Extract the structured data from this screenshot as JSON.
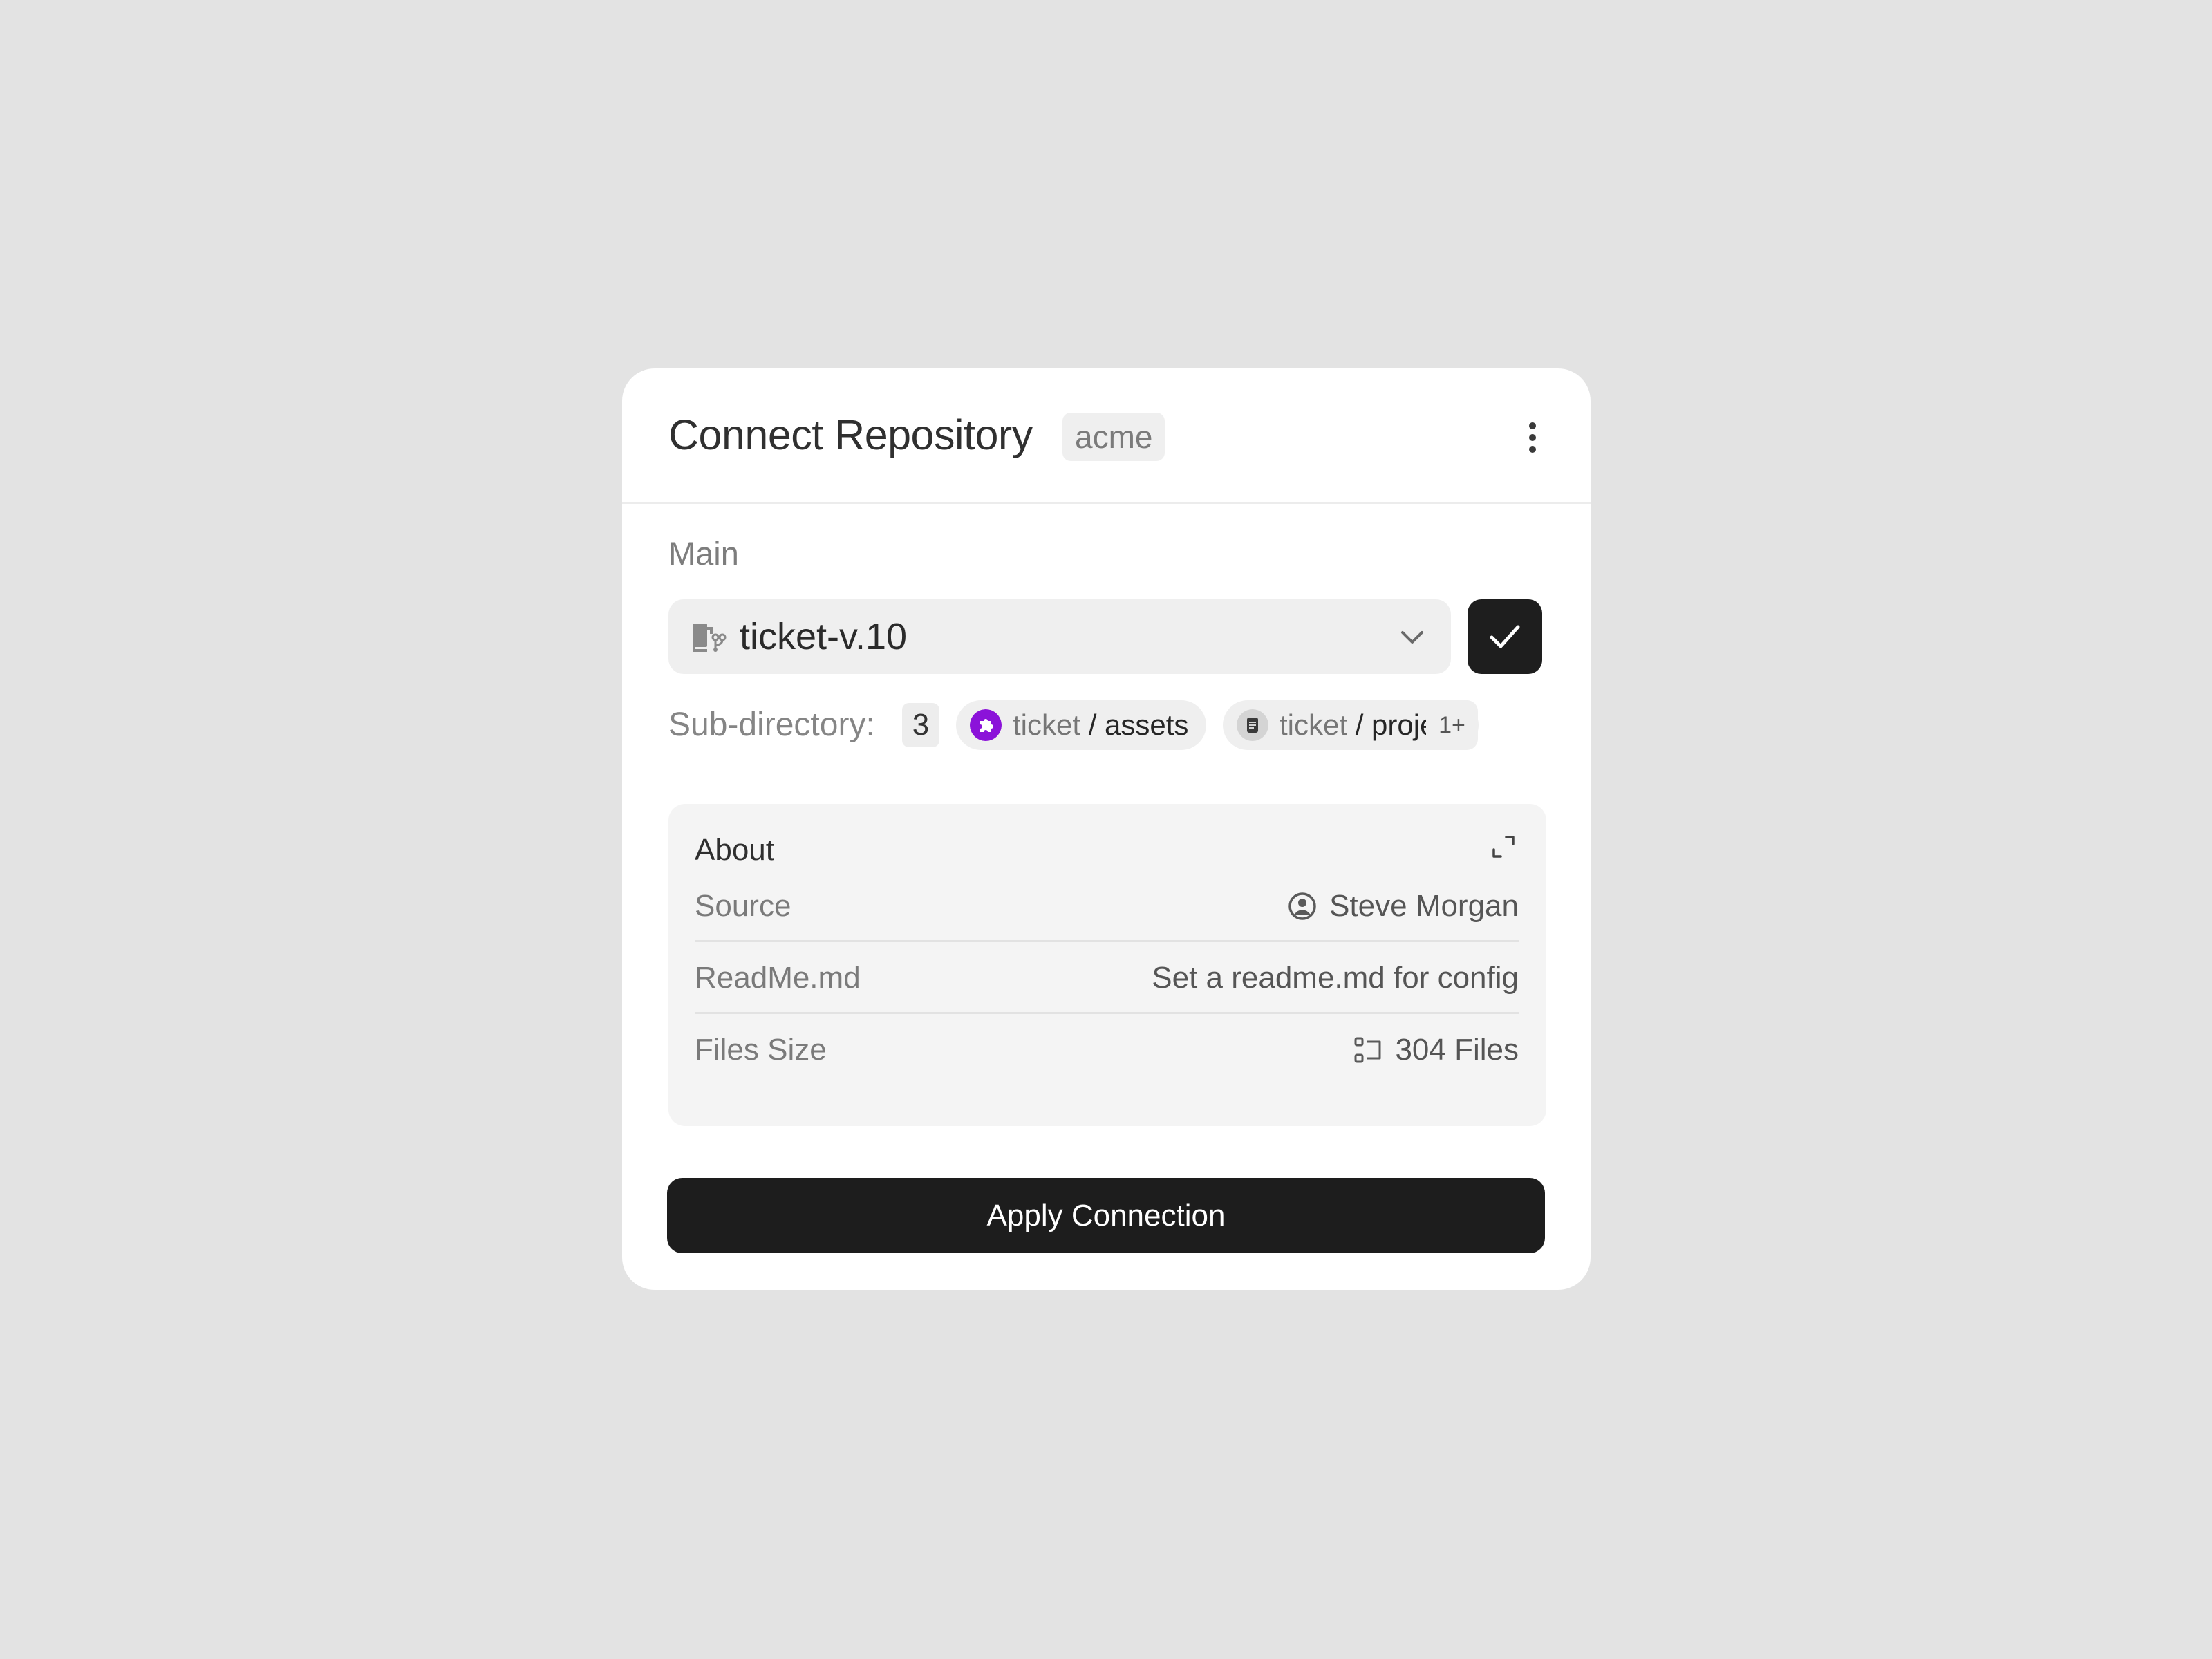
{
  "header": {
    "title": "Connect Repository",
    "org_badge": "acme",
    "more_icon": "more-vertical-icon"
  },
  "branch": {
    "section_label": "Main",
    "selected": "ticket-v.10",
    "icon": "folder-branch-icon",
    "dropdown_icon": "chevron-down-icon",
    "confirm_icon": "check-icon"
  },
  "subdirectory": {
    "label": "Sub-directory:",
    "count": "3",
    "chips": [
      {
        "prefix": "ticket",
        "separator": " / ",
        "name": "assets",
        "icon": "puzzle-icon",
        "icon_color": "#8b12d9"
      },
      {
        "prefix": "ticket",
        "separator": " / ",
        "name": "project",
        "icon": "document-icon",
        "icon_color": "#d4d4d4"
      }
    ],
    "more_label": "1+"
  },
  "about": {
    "title": "About",
    "expand_icon": "expand-icon",
    "rows": [
      {
        "label": "Source",
        "value": "Steve Morgan",
        "icon": "user-circle-icon"
      },
      {
        "label": "ReadMe.md",
        "value": "Set a readme.md for config"
      },
      {
        "label": "Files Size",
        "value": "304 Files",
        "icon": "file-tree-icon"
      }
    ]
  },
  "footer": {
    "apply_label": "Apply Connection"
  },
  "colors": {
    "background": "#e3e3e3",
    "card": "#ffffff",
    "primary_button": "#1d1d1d",
    "accent_purple": "#8b12d9"
  }
}
